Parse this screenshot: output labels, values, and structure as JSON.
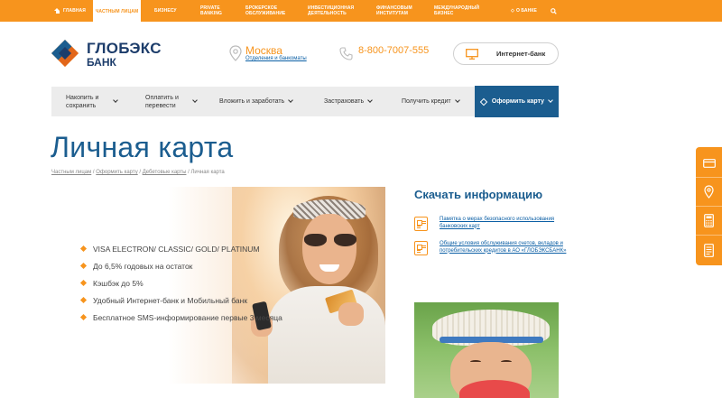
{
  "topbar": {
    "items": [
      {
        "label": "Главная"
      },
      {
        "label": "Частным лицам"
      },
      {
        "label": "Бизнесу"
      },
      {
        "label": "Private banking"
      },
      {
        "label": "Брокерское обслуживание"
      },
      {
        "label": "Инвестиционная деятельность"
      },
      {
        "label": "Финансовым институтам"
      },
      {
        "label": "Международный бизнес"
      },
      {
        "label": "О банке"
      }
    ]
  },
  "header": {
    "logo_name": "ГЛОБЭКС",
    "logo_sub": "БАНК",
    "city": "Москва",
    "city_links": "Отделения и банкоматы",
    "phone": "8-800-7007-555",
    "ibank_label": "Интернет-банк"
  },
  "nav": {
    "items": [
      {
        "label": "Накопить и сохранить"
      },
      {
        "label": "Оплатить и перевести"
      },
      {
        "label": "Вложить и заработать"
      },
      {
        "label": "Застраховать"
      },
      {
        "label": "Получить кредит"
      },
      {
        "label": "Оформить карту"
      }
    ]
  },
  "page": {
    "title": "Личная карта",
    "breadcrumbs": [
      "Частным лицам",
      "Оформить карту",
      "Дебетовые карты",
      "Личная карта"
    ]
  },
  "features": [
    "VISA ELECTRON/ CLASSIC/ GOLD/ PLATINUM",
    "До 6,5% годовых на остаток",
    "Кэшбэк до 5%",
    "Удобный Интернет-банк и Мобильный банк",
    "Бесплатное SMS-информирование первые 3 месяца"
  ],
  "downloads": {
    "title": "Скачать информацию",
    "items": [
      "Памятка о мерах безопасного использования банковских карт",
      "Общие условия обслуживания счетов, вкладов и потребительских кредитов в АО «ГЛОБЭКСБАНК»"
    ]
  },
  "sidepanel": {
    "tools": [
      "card-icon",
      "location-icon",
      "calculator-icon",
      "document-icon"
    ]
  },
  "colors": {
    "accent": "#f7941d",
    "brand_blue": "#1b5d8f",
    "logo_blue": "#1d3d6b"
  }
}
